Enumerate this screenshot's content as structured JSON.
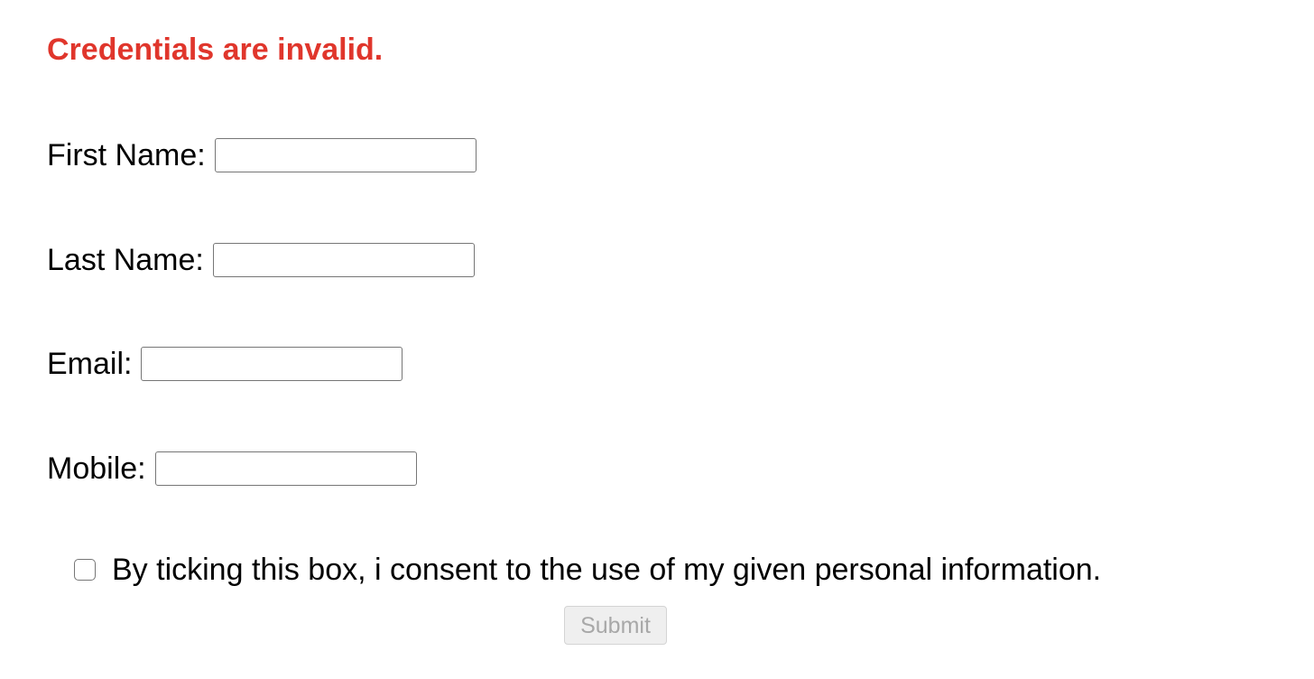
{
  "error": {
    "message": "Credentials are invalid.",
    "color": "#e0362c"
  },
  "form": {
    "first_name": {
      "label": "First Name:",
      "value": ""
    },
    "last_name": {
      "label": "Last Name:",
      "value": ""
    },
    "email": {
      "label": "Email:",
      "value": ""
    },
    "mobile": {
      "label": "Mobile:",
      "value": ""
    },
    "consent": {
      "label": "By ticking this box, i consent to the use of my given personal information.",
      "checked": false
    },
    "submit": {
      "label": "Submit",
      "disabled": true
    }
  }
}
